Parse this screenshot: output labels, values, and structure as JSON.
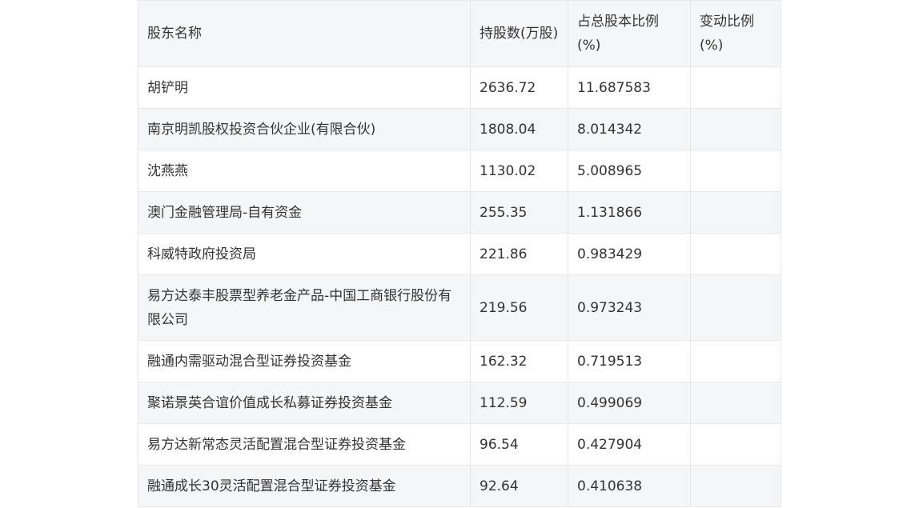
{
  "table": {
    "headers": [
      "股东名称",
      "持股数(万股)",
      "占总股本比例(%)",
      "变动比例(%)"
    ],
    "rows": [
      [
        "胡铲明",
        "2636.72",
        "11.687583",
        ""
      ],
      [
        "南京明凯股权投资合伙企业(有限合伙)",
        "1808.04",
        "8.014342",
        ""
      ],
      [
        "沈燕燕",
        "1130.02",
        "5.008965",
        ""
      ],
      [
        "澳门金融管理局-自有资金",
        "255.35",
        "1.131866",
        ""
      ],
      [
        "科威特政府投资局",
        "221.86",
        "0.983429",
        ""
      ],
      [
        "易方达泰丰股票型养老金产品-中国工商银行股份有限公司",
        "219.56",
        "0.973243",
        ""
      ],
      [
        "融通内需驱动混合型证券投资基金",
        "162.32",
        "0.719513",
        ""
      ],
      [
        "聚诺景英合谊价值成长私募证券投资基金",
        "112.59",
        "0.499069",
        ""
      ],
      [
        "易方达新常态灵活配置混合型证券投资基金",
        "96.54",
        "0.427904",
        ""
      ],
      [
        "融通成长30灵活配置混合型证券投资基金",
        "92.64",
        "0.410638",
        ""
      ]
    ]
  }
}
